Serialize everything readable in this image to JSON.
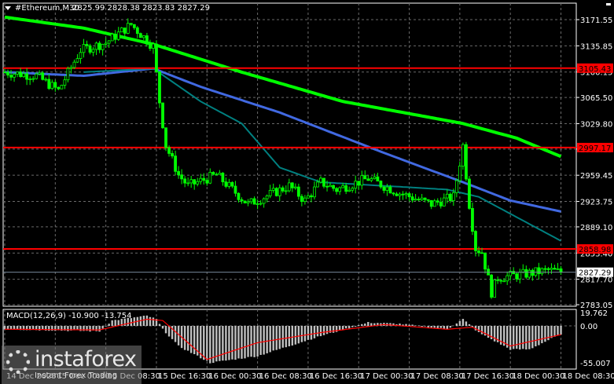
{
  "header": {
    "symbol": "#Ethereum,M30",
    "ohlc": "2825.99 2828.38 2823.83 2827.29"
  },
  "watermark": {
    "name": "instaforex",
    "tagline": "Instant Forex Trading"
  },
  "colors": {
    "bg": "#000000",
    "candle": "#00ff00",
    "ma200": "#00ff00",
    "ma100": "#4169e1",
    "ma50": "#008080",
    "level": "#ff0000",
    "macd_hist": "#c0c0c0",
    "macd_signal": "#ff0000",
    "grid": "#6a6a6a"
  },
  "chart_data": {
    "type": "candlestick",
    "title": "#Ethereum,M30",
    "price_ticks": [
      "3171.55",
      "3135.85",
      "3100.15",
      "3065.50",
      "3029.80",
      "2995.15",
      "2959.45",
      "2923.75",
      "2889.10",
      "2853.40",
      "2817.70",
      "2783.05"
    ],
    "ylim": [
      2783.05,
      3171.55
    ],
    "levels": [
      {
        "value": 3105.43,
        "label": "3105.43"
      },
      {
        "value": 2997.17,
        "label": "2997.17"
      },
      {
        "value": 2858.98,
        "label": "2858.98"
      }
    ],
    "current_price": {
      "value": 2827.29,
      "label": "2827.29"
    },
    "time_ticks": [
      {
        "bar": 0,
        "label": "14 Dec 2025"
      },
      {
        "bar": 16,
        "label": "15 Dec 00:30"
      },
      {
        "bar": 32,
        "label": "15 Dec 08:30"
      },
      {
        "bar": 48,
        "label": "15 Dec 16:30"
      },
      {
        "bar": 64,
        "label": "16 Dec 00:30"
      },
      {
        "bar": 80,
        "label": "16 Dec 08:30"
      },
      {
        "bar": 96,
        "label": "16 Dec 16:30"
      },
      {
        "bar": 112,
        "label": "17 Dec 00:30"
      },
      {
        "bar": 128,
        "label": "17 Dec 08:30"
      },
      {
        "bar": 144,
        "label": "17 Dec 16:30"
      },
      {
        "bar": 160,
        "label": "18 Dec 00:30"
      },
      {
        "bar": 176,
        "label": "18 Dec 08:30"
      }
    ],
    "bars": 177,
    "close_keypoints": [
      [
        0,
        3100
      ],
      [
        10,
        3095
      ],
      [
        17,
        3075
      ],
      [
        24,
        3130
      ],
      [
        32,
        3140
      ],
      [
        40,
        3165
      ],
      [
        47,
        3135
      ],
      [
        49,
        3060
      ],
      [
        51,
        3000
      ],
      [
        55,
        2960
      ],
      [
        58,
        2945
      ],
      [
        67,
        2960
      ],
      [
        77,
        2920
      ],
      [
        90,
        2945
      ],
      [
        95,
        2925
      ],
      [
        100,
        2950
      ],
      [
        105,
        2940
      ],
      [
        115,
        2955
      ],
      [
        125,
        2935
      ],
      [
        135,
        2920
      ],
      [
        142,
        2930
      ],
      [
        145,
        3000
      ],
      [
        147,
        2920
      ],
      [
        149,
        2860
      ],
      [
        151,
        2855
      ],
      [
        154,
        2800
      ],
      [
        156,
        2820
      ],
      [
        165,
        2825
      ],
      [
        172,
        2830
      ],
      [
        176,
        2827.29
      ]
    ],
    "series": [
      {
        "name": "MA200",
        "keypoints": [
          [
            0,
            3175
          ],
          [
            25,
            3160
          ],
          [
            47,
            3138
          ],
          [
            75,
            3100
          ],
          [
            107,
            3060
          ],
          [
            145,
            3030
          ],
          [
            162,
            3010
          ],
          [
            176,
            2985
          ]
        ]
      },
      {
        "name": "MA100",
        "keypoints": [
          [
            0,
            3100
          ],
          [
            25,
            3095
          ],
          [
            47,
            3105
          ],
          [
            62,
            3080
          ],
          [
            87,
            3045
          ],
          [
            120,
            2990
          ],
          [
            145,
            2950
          ],
          [
            160,
            2925
          ],
          [
            176,
            2910
          ]
        ]
      },
      {
        "name": "MA50",
        "keypoints": [
          [
            25,
            3100
          ],
          [
            47,
            3105
          ],
          [
            62,
            3060
          ],
          [
            75,
            3030
          ],
          [
            87,
            2970
          ],
          [
            100,
            2950
          ],
          [
            120,
            2945
          ],
          [
            140,
            2940
          ],
          [
            150,
            2930
          ],
          [
            176,
            2870
          ]
        ]
      }
    ],
    "macd": {
      "label": "MACD(12,26,9) -10.900 -13.754",
      "ticks": [
        "19.762",
        "0.00",
        "-55.007"
      ],
      "ylim": [
        -55.007,
        19.762
      ],
      "hist_keypoints": [
        [
          0,
          -5
        ],
        [
          30,
          -8
        ],
        [
          34,
          8
        ],
        [
          45,
          15
        ],
        [
          48,
          10
        ],
        [
          50,
          -5
        ],
        [
          55,
          -30
        ],
        [
          65,
          -55
        ],
        [
          80,
          -45
        ],
        [
          100,
          -15
        ],
        [
          115,
          5
        ],
        [
          125,
          3
        ],
        [
          140,
          -5
        ],
        [
          145,
          10
        ],
        [
          150,
          -10
        ],
        [
          160,
          -35
        ],
        [
          166,
          -35
        ],
        [
          176,
          -12
        ]
      ],
      "signal_keypoints": [
        [
          0,
          -5
        ],
        [
          30,
          -6
        ],
        [
          45,
          10
        ],
        [
          50,
          8
        ],
        [
          64,
          -50
        ],
        [
          80,
          -25
        ],
        [
          100,
          -10
        ],
        [
          120,
          2
        ],
        [
          140,
          -5
        ],
        [
          148,
          -2
        ],
        [
          160,
          -30
        ],
        [
          176,
          -13
        ]
      ]
    }
  }
}
